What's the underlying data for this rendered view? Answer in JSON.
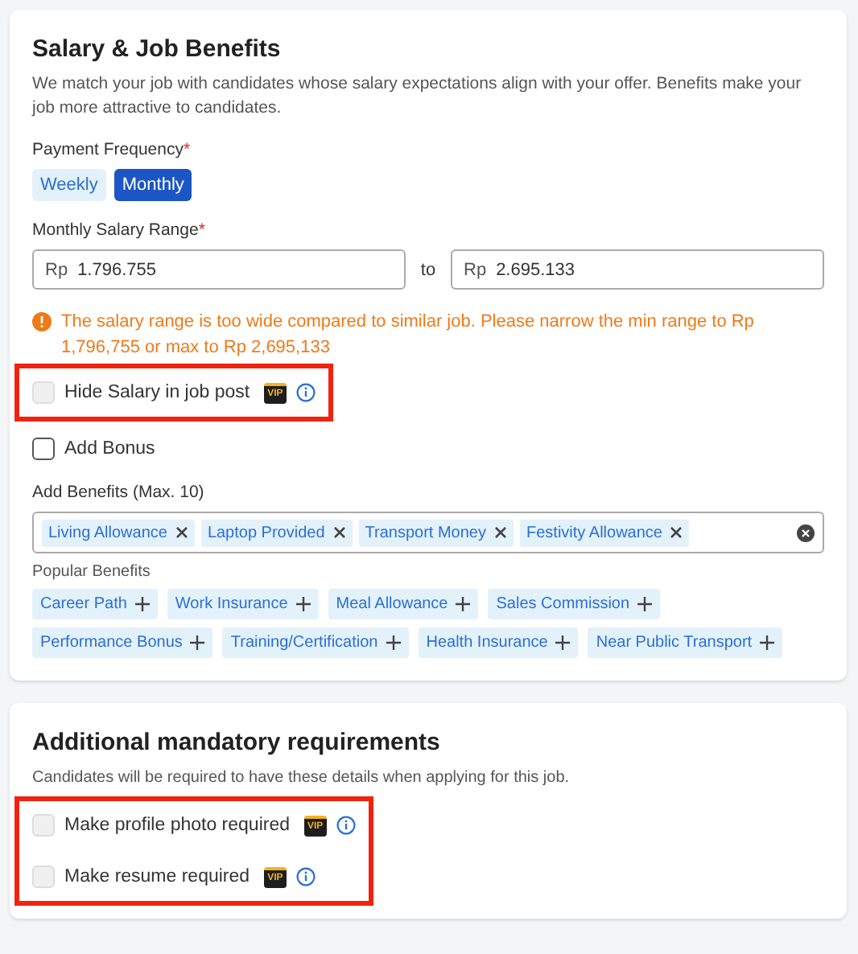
{
  "salary_section": {
    "title": "Salary & Job Benefits",
    "description": "We match your job with candidates whose salary expectations align with your offer. Benefits make your job more attractive to candidates.",
    "payment_frequency": {
      "label": "Payment Frequency",
      "required_mark": "*",
      "options": [
        {
          "label": "Weekly",
          "selected": false
        },
        {
          "label": "Monthly",
          "selected": true
        }
      ]
    },
    "salary_range": {
      "label": "Monthly Salary Range",
      "required_mark": "*",
      "min": {
        "prefix": "Rp",
        "value": "1.796.755"
      },
      "separator": "to",
      "max": {
        "prefix": "Rp",
        "value": "2.695.133"
      }
    },
    "warning": "The salary range is too wide compared to similar job. Please narrow the min range to Rp 1,796,755 or max to Rp 2,695,133",
    "options": [
      {
        "label": "Hide Salary in job post",
        "checked": false,
        "disabled": true,
        "badge": "VIP",
        "info": true,
        "highlighted": true
      },
      {
        "label": "Add Bonus",
        "checked": false,
        "disabled": false,
        "info": false,
        "highlighted": false
      }
    ],
    "benefits": {
      "label": "Add Benefits (Max. 10)",
      "selected": [
        "Living Allowance",
        "Laptop Provided",
        "Transport Money",
        "Festivity Allowance"
      ],
      "popular_label": "Popular Benefits",
      "popular": [
        "Career Path",
        "Work Insurance",
        "Meal Allowance",
        "Sales Commission",
        "Performance Bonus",
        "Training/Certification",
        "Health Insurance",
        "Near Public Transport"
      ]
    }
  },
  "requirements_section": {
    "title": "Additional mandatory requirements",
    "description": "Candidates will be required to have these details when applying for this job.",
    "options": [
      {
        "label": "Make profile photo required",
        "checked": false,
        "disabled": true,
        "badge": "VIP",
        "info": true,
        "highlighted": true
      },
      {
        "label": "Make resume required",
        "checked": false,
        "disabled": true,
        "badge": "VIP",
        "info": true,
        "highlighted": true
      }
    ]
  }
}
